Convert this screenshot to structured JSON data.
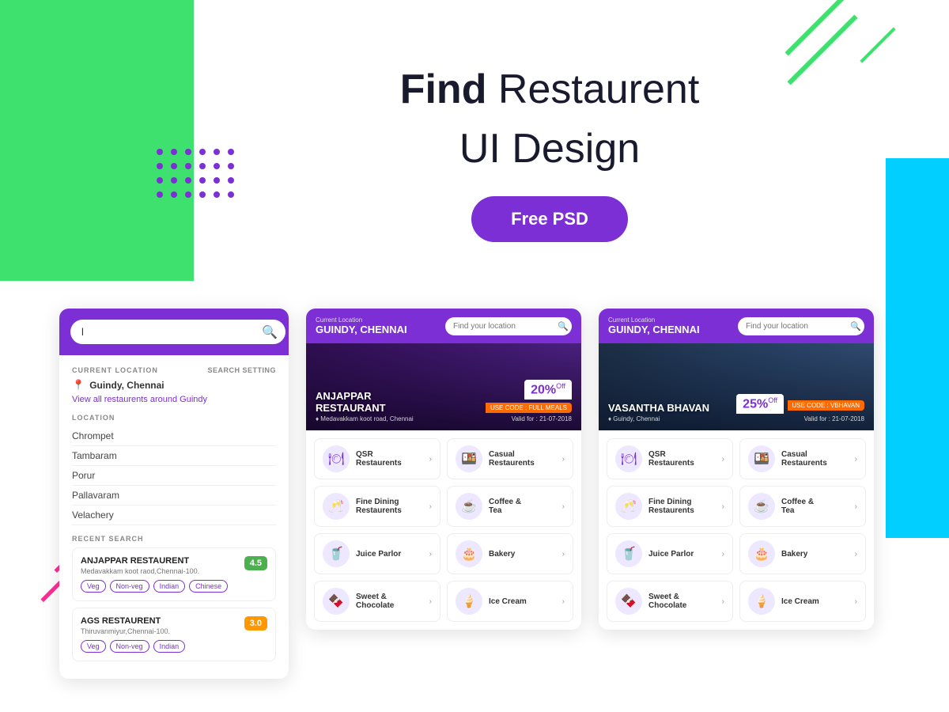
{
  "page": {
    "title": "Find Restaurent UI Design",
    "title_bold": "Find",
    "title_rest": " Restaurent",
    "subtitle": "UI Design",
    "cta_button": "Free PSD",
    "accent_color": "#7B2FD4",
    "green_color": "#3EE06E",
    "cyan_color": "#00CFFF",
    "pink_color": "#FF2D95"
  },
  "screen1": {
    "search_placeholder": "l",
    "current_location_label": "CURRENT LOCATION",
    "search_setting_label": "SEARCH SETTING",
    "location_name": "Guindy, Chennai",
    "view_all_text": "View all restaurents around Guindy",
    "location_label": "LOCATION",
    "locations": [
      "Chrompet",
      "Tambaram",
      "Porur",
      "Pallavaram",
      "Velachery"
    ],
    "recent_search_label": "RECENT SEARCH",
    "restaurants": [
      {
        "name": "ANJAPPAR RESTAURENT",
        "address": "Medavakkam koot raod,Chennai-100.",
        "rating": "4.5",
        "rating_color": "#4CAF50",
        "tags": [
          "Veg",
          "Non-veg",
          "Indian",
          "Chinese"
        ]
      },
      {
        "name": "AGS RESTAURENT",
        "address": "Thiruvanmiyur,Chennai-100.",
        "rating": "3.0",
        "rating_color": "#FF9800",
        "tags": [
          "Veg",
          "Non-veg",
          "Indian"
        ]
      }
    ]
  },
  "screen2": {
    "current_loc_label": "Current Location",
    "location_name": "GUINDY, CHENNAI",
    "search_placeholder": "Find your location",
    "banner": {
      "restaurant_name": "ANJAPPAR RESTAURANT",
      "address": "♦ Medavakkam koot road, Chennai",
      "discount": "20%",
      "discount_off": "Off",
      "code_label": "USE CODE : FULL MEALS",
      "valid": "Valid for : 21-07-2018"
    },
    "categories": [
      {
        "icon": "🍽",
        "label": "QSR\nRestaurents"
      },
      {
        "icon": "🍱",
        "label": "Casual\nRestaurents"
      },
      {
        "icon": "🥂",
        "label": "Fine Dining\nRestaurents"
      },
      {
        "icon": "☕",
        "label": "Coffee &\nTea"
      },
      {
        "icon": "🥤",
        "label": "Juice Parlor"
      },
      {
        "icon": "🎂",
        "label": "Bakery"
      },
      {
        "icon": "🍫",
        "label": "Sweet &\nChocolate"
      },
      {
        "icon": "🍦",
        "label": "Ice Cream"
      }
    ]
  },
  "screen3": {
    "current_loc_label": "Current Location",
    "location_name": "GUINDY, CHENNAI",
    "search_placeholder": "Find your location",
    "banner": {
      "restaurant_name": "VASANTHA BHAVAN",
      "address": "♦ Guindy, Chennai",
      "discount": "25%",
      "discount_off": "Off",
      "code_label": "USE CODE : VBHAVAN",
      "valid": "Valid for : 21-07-2018"
    },
    "categories": [
      {
        "icon": "🍽",
        "label": "QSR\nRestaurents"
      },
      {
        "icon": "🍱",
        "label": "Casual\nRestaurents"
      },
      {
        "icon": "🥂",
        "label": "Fine Dining\nRestaurents"
      },
      {
        "icon": "☕",
        "label": "Coffee &\nTea"
      },
      {
        "icon": "🥤",
        "label": "Juice Parlor"
      },
      {
        "icon": "🎂",
        "label": "Bakery"
      },
      {
        "icon": "🍫",
        "label": "Sweet &\nChocolate"
      },
      {
        "icon": "🍦",
        "label": "Ice Cream"
      }
    ]
  }
}
